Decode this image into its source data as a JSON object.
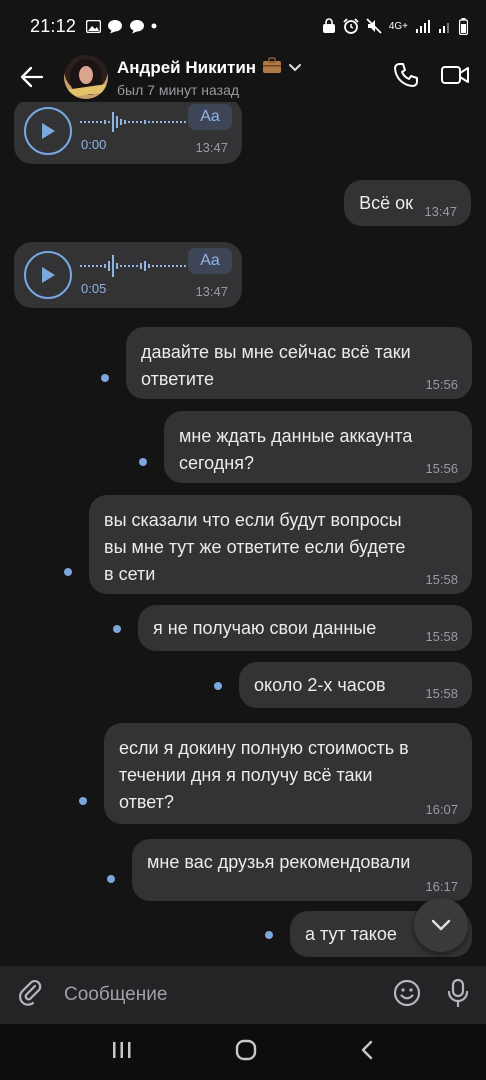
{
  "status_bar": {
    "time": "21:12",
    "network": "4G+"
  },
  "header": {
    "name": "Андрей Никитин",
    "last_seen": "был 7 минут назад"
  },
  "voice_messages": [
    {
      "duration": "0:00",
      "transcribe_label": "Aa",
      "time": "13:47"
    },
    {
      "duration": "0:05",
      "transcribe_label": "Aa",
      "time": "13:47"
    }
  ],
  "messages": [
    {
      "text": "Всё ок",
      "time": "13:47"
    },
    {
      "text": "давайте вы мне сейчас всё таки\nответите",
      "time": "15:56"
    },
    {
      "text": "мне ждать данные аккаунта\nсегодня?",
      "time": "15:56"
    },
    {
      "text": "вы сказали что если будут вопросы\nвы мне тут же ответите если будете\nв сети",
      "time": "15:58"
    },
    {
      "text": "я не получаю свои данные",
      "time": "15:58"
    },
    {
      "text": "около 2-х часов",
      "time": "15:58"
    },
    {
      "text": "если я докину полную стоимость в\nтечении дня я получу всё таки\nответ?",
      "time": "16:07"
    },
    {
      "text": "мне вас друзья рекомендовали",
      "time": "16:17"
    },
    {
      "text": "а тут такое",
      "time": ""
    }
  ],
  "composer": {
    "placeholder": "Сообщение"
  },
  "colors": {
    "background": "#141414",
    "bubble": "#333336",
    "accent": "#7da7dc"
  }
}
